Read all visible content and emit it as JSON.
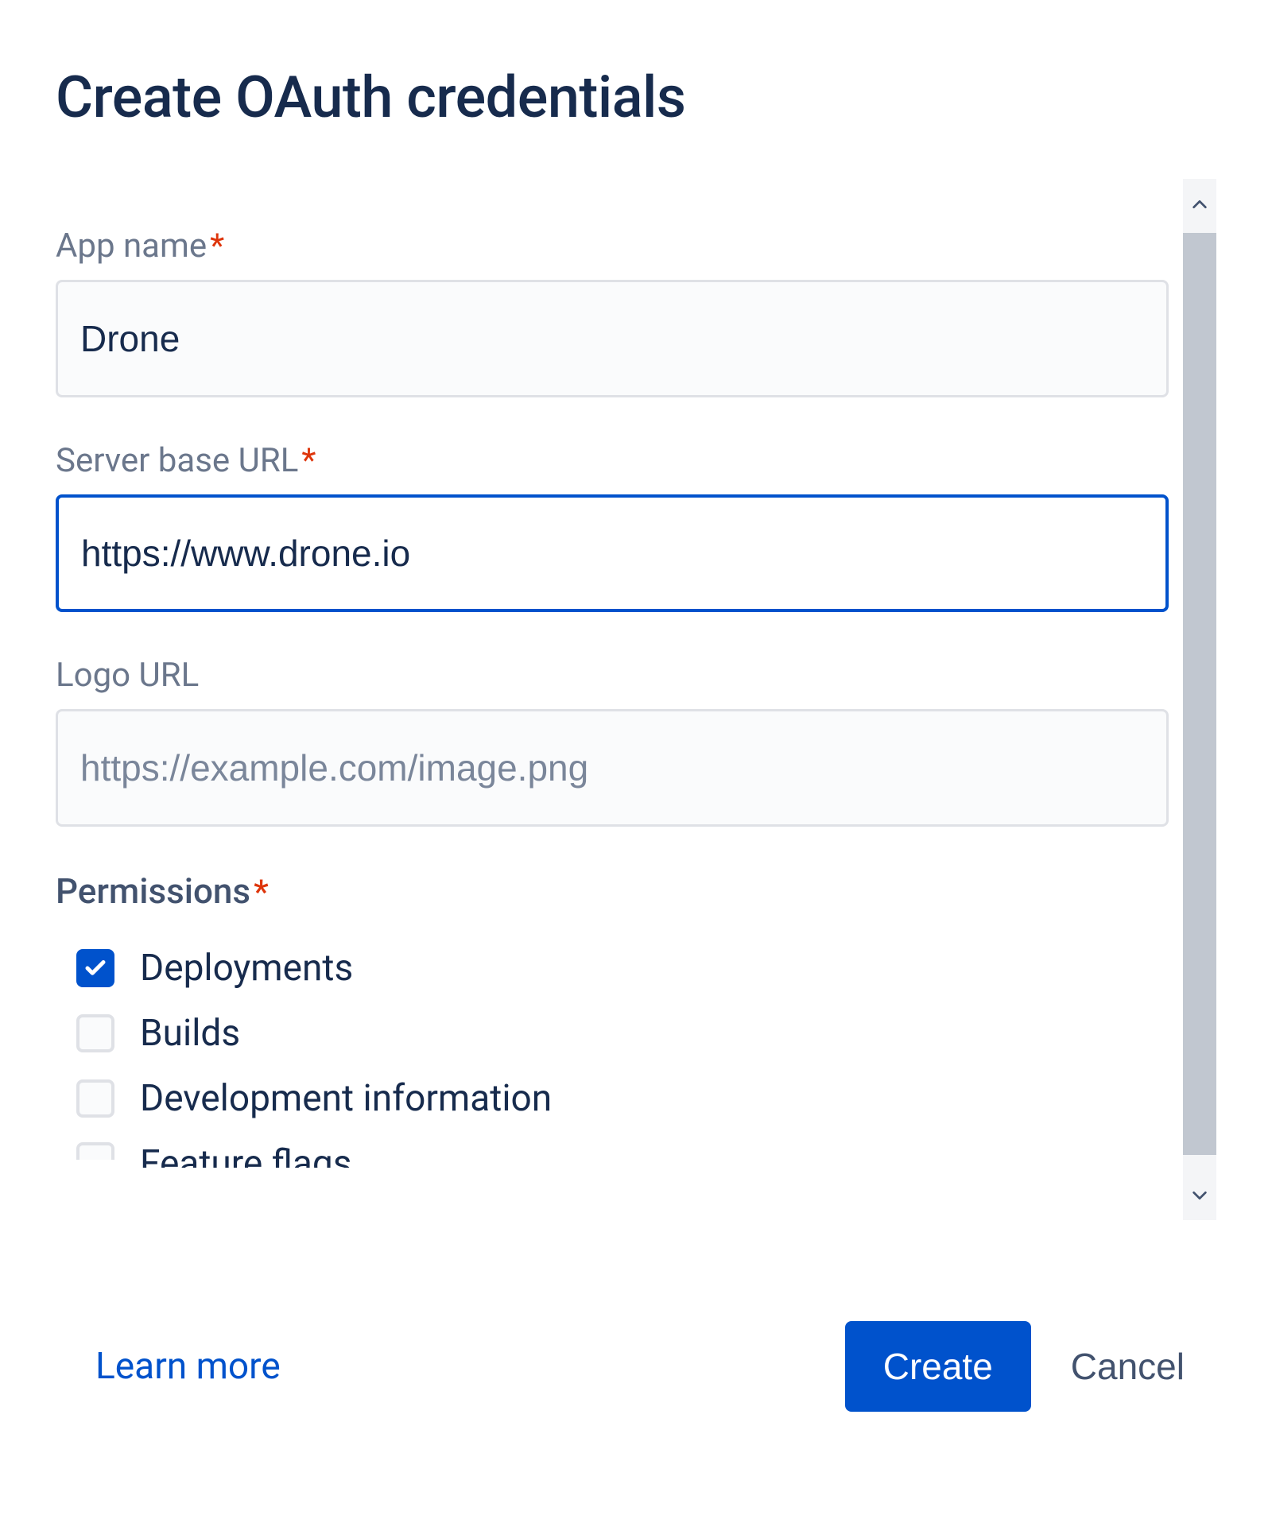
{
  "title": "Create OAuth credentials",
  "fields": {
    "appName": {
      "label": "App name",
      "required": true,
      "value": "Drone"
    },
    "serverBaseURL": {
      "label": "Server base URL",
      "required": true,
      "value": "https://www.drone.io",
      "focused": true
    },
    "logoURL": {
      "label": "Logo URL",
      "required": false,
      "value": "",
      "placeholder": "https://example.com/image.png"
    }
  },
  "permissions": {
    "heading": "Permissions",
    "required": true,
    "items": [
      {
        "label": "Deployments",
        "checked": true
      },
      {
        "label": "Builds",
        "checked": false
      },
      {
        "label": "Development information",
        "checked": false
      },
      {
        "label": "Feature flags",
        "checked": false,
        "cutoff": true
      }
    ]
  },
  "footer": {
    "learnMore": "Learn more",
    "primary": "Create",
    "secondary": "Cancel"
  },
  "colors": {
    "primary": "#0052CC",
    "textHeading": "#172B4D",
    "textSubtle": "#6B778C",
    "requiredMark": "#DE350B",
    "border": "#DFE1E6"
  }
}
